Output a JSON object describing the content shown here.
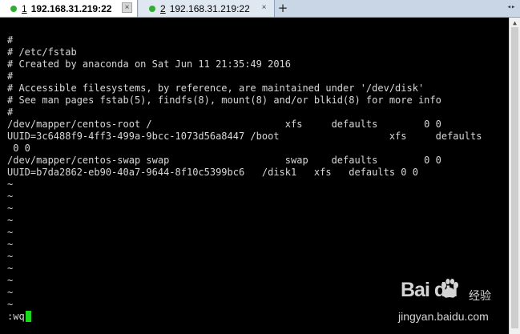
{
  "tabs": [
    {
      "number": "1",
      "title": "192.168.31.219:22",
      "active": true,
      "close": "×"
    },
    {
      "number": "2",
      "title": "192.168.31.219:22",
      "active": false,
      "close": "×"
    }
  ],
  "new_tab_label": "+",
  "tab_menu_icon": "◂▸",
  "colors": {
    "status_dot": "#2fae2f",
    "cursor": "#19d819",
    "terminal_bg": "#000000",
    "terminal_fg": "#d8d8d8"
  },
  "terminal": {
    "lines": [
      "",
      "#",
      "# /etc/fstab",
      "# Created by anaconda on Sat Jun 11 21:35:49 2016",
      "#",
      "# Accessible filesystems, by reference, are maintained under '/dev/disk'",
      "# See man pages fstab(5), findfs(8), mount(8) and/or blkid(8) for more info",
      "#",
      "/dev/mapper/centos-root /                       xfs     defaults        0 0",
      "UUID=3c6488f9-4ff3-499a-9bcc-1073d56a8447 /boot                   xfs     defaults",
      " 0 0",
      "/dev/mapper/centos-swap swap                    swap    defaults        0 0",
      "UUID=b7da2862-eb90-40a7-9644-8f10c5399bc6   /disk1   xfs   defaults 0 0",
      "~",
      "~",
      "~",
      "~",
      "~",
      "~",
      "~",
      "~",
      "~",
      "~",
      "~"
    ],
    "command": ":wq"
  },
  "watermark": {
    "brand": "Bai  du",
    "sub": "经验",
    "url": "jingyan.baidu.com"
  }
}
